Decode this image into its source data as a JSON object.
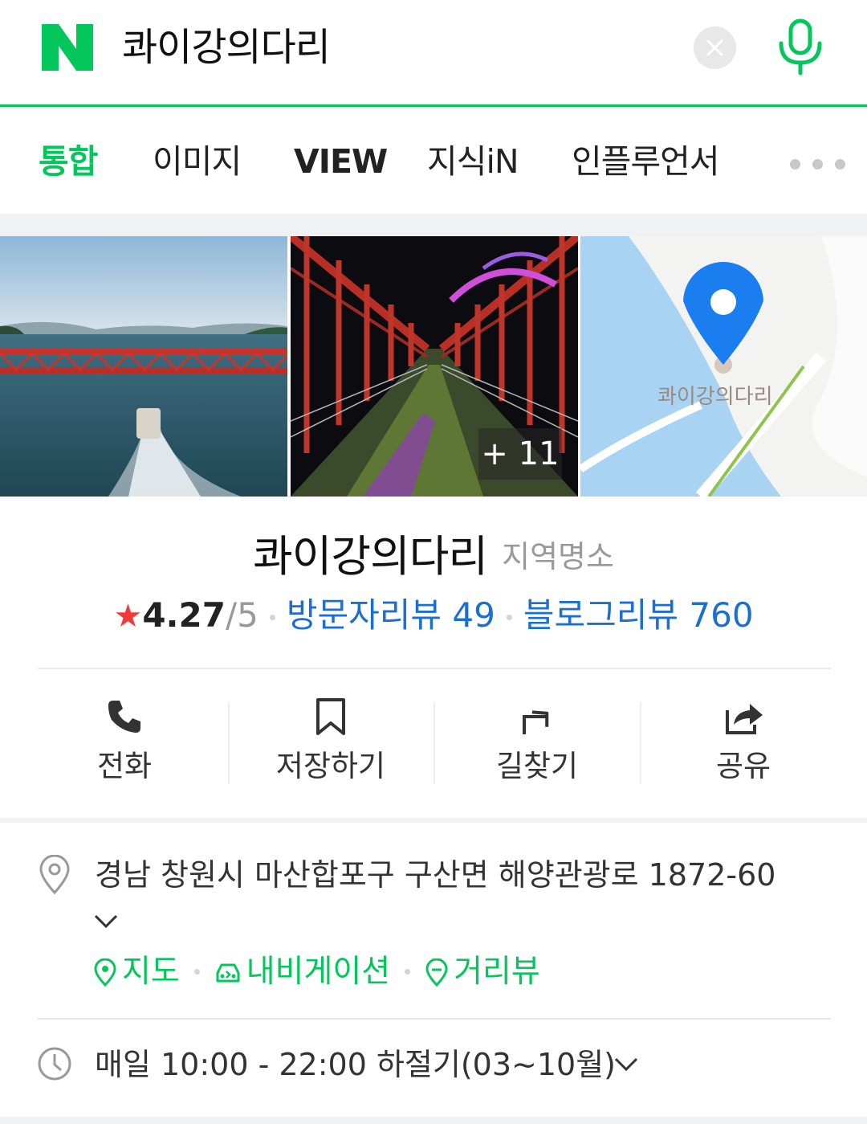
{
  "search": {
    "query": "콰이강의다리",
    "logo_letter": "N",
    "clear_icon": "close-icon",
    "mic_icon": "microphone-icon"
  },
  "tabs": [
    {
      "label": "통합",
      "active": true
    },
    {
      "label": "이미지"
    },
    {
      "label": "VIEW"
    },
    {
      "label": "지식iN"
    },
    {
      "label": "인플루언서"
    }
  ],
  "photos": {
    "more_count": "+ 11",
    "map_label": "콰이강의다리"
  },
  "place": {
    "name": "콰이강의다리",
    "category": "지역명소",
    "star": "★",
    "rating": "4.27",
    "rating_max": "/5",
    "visitor_review": "방문자리뷰 49",
    "blog_review": "블로그리뷰 760"
  },
  "actions": [
    {
      "label": "전화",
      "icon": "phone-icon"
    },
    {
      "label": "저장하기",
      "icon": "bookmark-icon"
    },
    {
      "label": "길찾기",
      "icon": "directions-icon"
    },
    {
      "label": "공유",
      "icon": "share-icon"
    }
  ],
  "info": {
    "address": "경남 창원시 마산합포구 구산면 해양관광로 1872-60",
    "links": [
      {
        "label": "지도",
        "icon": "map-pin-icon"
      },
      {
        "label": "내비게이션",
        "icon": "car-icon"
      },
      {
        "label": "거리뷰",
        "icon": "street-view-icon"
      }
    ],
    "hours": "매일 10:00 - 22:00 하절기(03~10월)"
  },
  "colors": {
    "brand_green": "#03c75a",
    "link_blue": "#1a6fd1",
    "star_red": "#f23a3a"
  }
}
